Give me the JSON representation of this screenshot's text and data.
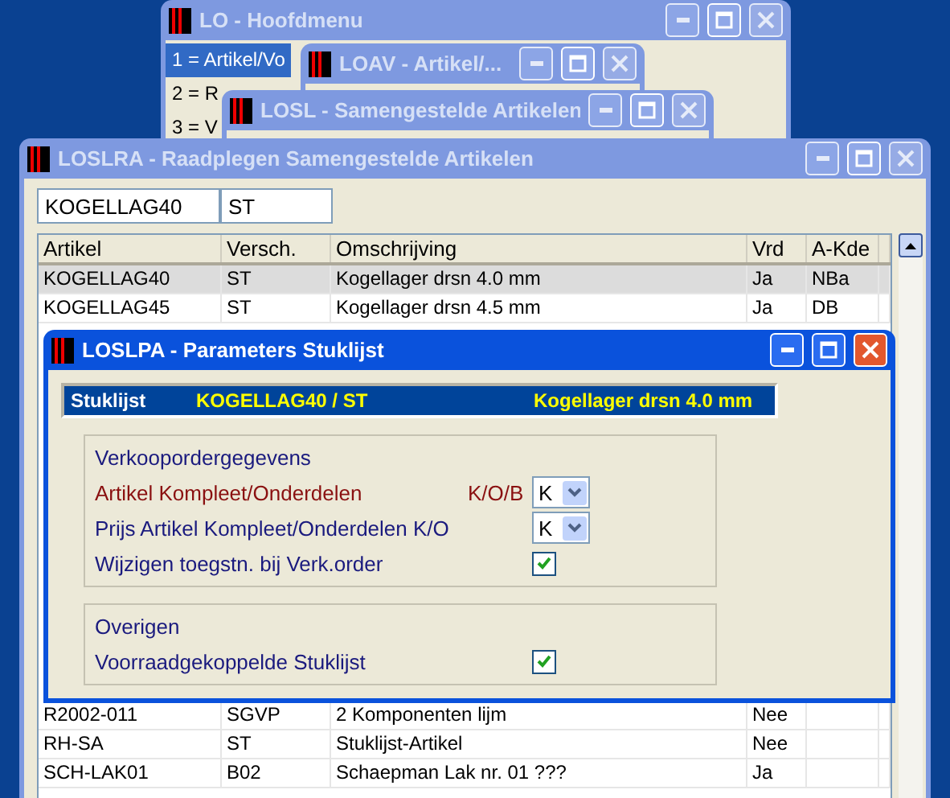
{
  "windows": [
    {
      "title": "LO - Hoofdmenu",
      "active": false,
      "menu": [
        {
          "label": "1 = Artikel/Vo",
          "selected": true
        },
        {
          "label": "2 = R",
          "selected": false
        },
        {
          "label": "3 = V",
          "selected": false
        }
      ]
    },
    {
      "title": "LOAV - Artikel/...",
      "active": false
    },
    {
      "title": "LOSL - Samengestelde Artikelen",
      "active": false
    }
  ],
  "browser": {
    "title": "LOSLRA - Raadplegen Samengestelde Artikelen",
    "active": false,
    "key_fields": [
      "KOGELLAG40",
      "ST"
    ],
    "table": {
      "columns": [
        "Artikel",
        "Versch.",
        "Omschrijving",
        "Vrd",
        "A-Kde"
      ],
      "rows_top": [
        {
          "cells": [
            "KOGELLAG40",
            "ST",
            "Kogellager drsn 4.0 mm",
            "Ja",
            "NBa"
          ],
          "selected": true
        },
        {
          "cells": [
            "KOGELLAG45",
            "ST",
            "Kogellager drsn 4.5 mm",
            "Ja",
            "DB"
          ],
          "selected": false
        }
      ],
      "rows_bottom": [
        {
          "cells": [
            "R2002-011",
            "SGVP",
            "2 Komponenten lijm",
            "Nee",
            ""
          ],
          "selected": false
        },
        {
          "cells": [
            "RH-SA",
            "ST",
            "Stuklijst-Artikel",
            "Nee",
            ""
          ],
          "selected": false
        },
        {
          "cells": [
            "SCH-LAK01",
            "B02",
            "Schaepman Lak nr. 01 ???",
            "Ja",
            ""
          ],
          "selected": false
        }
      ]
    }
  },
  "dialog": {
    "title": "LOSLPA - Parameters Stuklijst",
    "active": true,
    "header": {
      "label": "Stuklijst",
      "code": "KOGELLAG40 / ST",
      "description": "Kogellager drsn 4.0 mm"
    },
    "groups": [
      {
        "title": "Verkoopordergegevens",
        "fields": [
          {
            "kind": "select",
            "label": "Artikel Kompleet/Onderdelen",
            "suffix": "K/O/B",
            "value": "K",
            "focused": true
          },
          {
            "kind": "select",
            "label": "Prijs Artikel Kompleet/Onderdelen K/O",
            "value": "K",
            "focused": false
          },
          {
            "kind": "checkbox",
            "label": "Wijzigen toegstn. bij Verk.order",
            "checked": true,
            "focused": false
          }
        ]
      },
      {
        "title": "Overigen",
        "fields": [
          {
            "kind": "checkbox",
            "label": "Voorraadgekoppelde Stuklijst",
            "checked": true,
            "focused": false
          }
        ]
      }
    ]
  }
}
